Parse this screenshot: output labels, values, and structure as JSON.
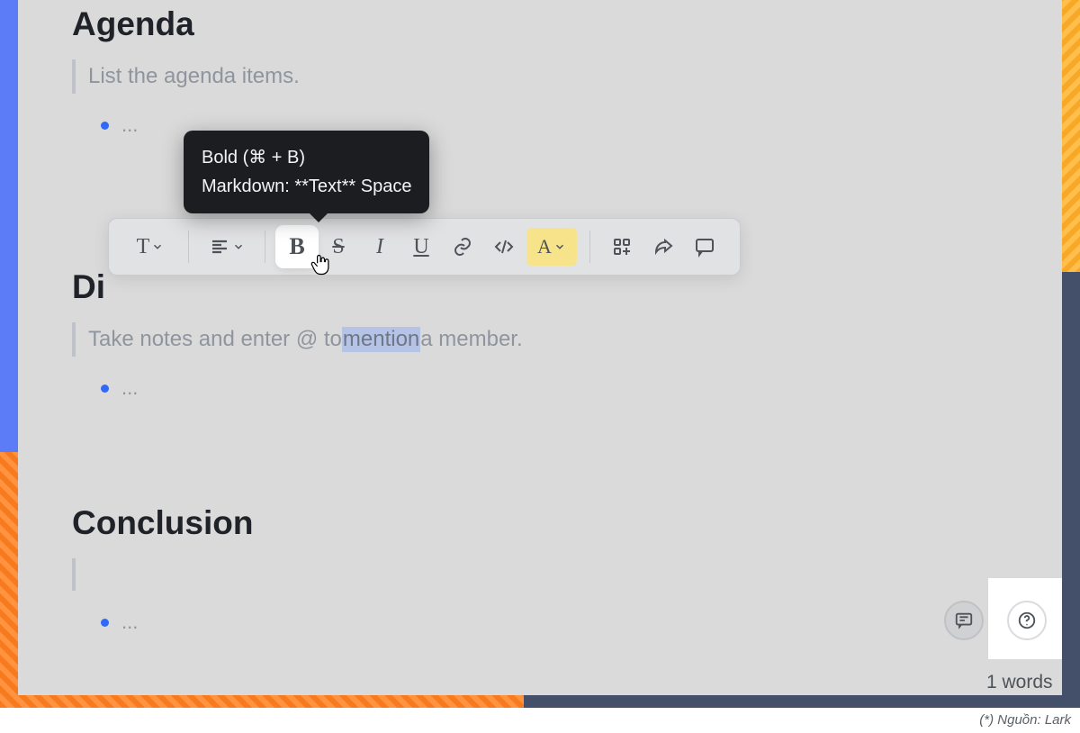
{
  "sections": {
    "agenda": {
      "title": "Agenda",
      "placeholder": "List the agenda items.",
      "bullet": "..."
    },
    "discussion": {
      "title_visible": "Di",
      "placeholder_pre": "Take notes and enter @ to ",
      "placeholder_sel": "mention",
      "placeholder_post": " a member.",
      "bullet": "..."
    },
    "conclusion": {
      "title": "Conclusion",
      "bullet": "..."
    }
  },
  "toolbar": {
    "text_style": "T",
    "bold": "B",
    "strike": "S",
    "italic": "I",
    "underline": "U",
    "textcolor": "A"
  },
  "tooltip": {
    "line1": "Bold (⌘ + B)",
    "line2": "Markdown: **Text** Space"
  },
  "footer": {
    "word_count": "1 words",
    "source": "(*) Nguồn: Lark"
  }
}
